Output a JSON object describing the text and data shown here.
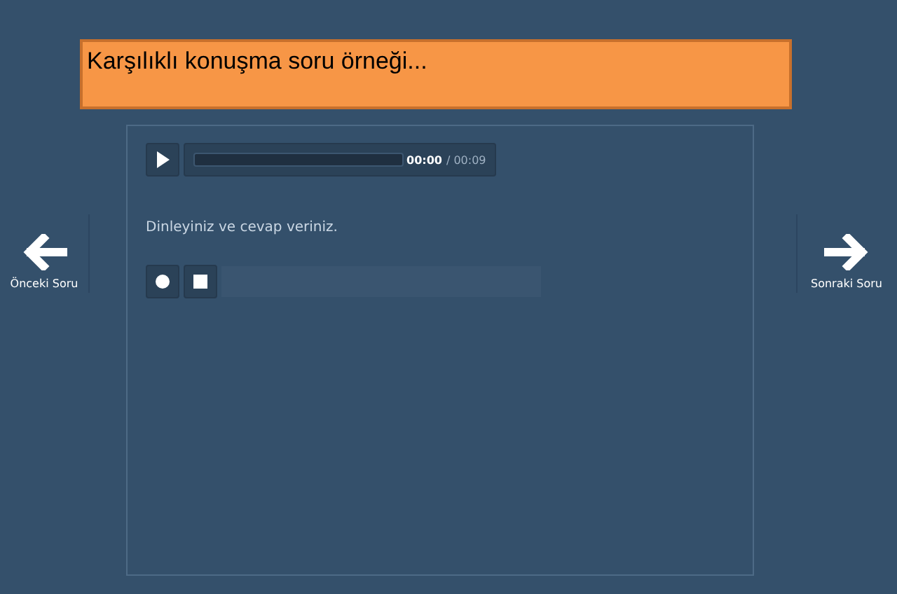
{
  "question_title": "Karşılıklı konuşma soru örneği...",
  "audio_player": {
    "current_time": "00:00",
    "total_time": "/ 00:09",
    "level": 0
  },
  "instruction": "Dinleyiniz ve cevap veriniz.",
  "nav": {
    "previous": "Önceki Soru",
    "next": "Sonraki Soru"
  }
}
